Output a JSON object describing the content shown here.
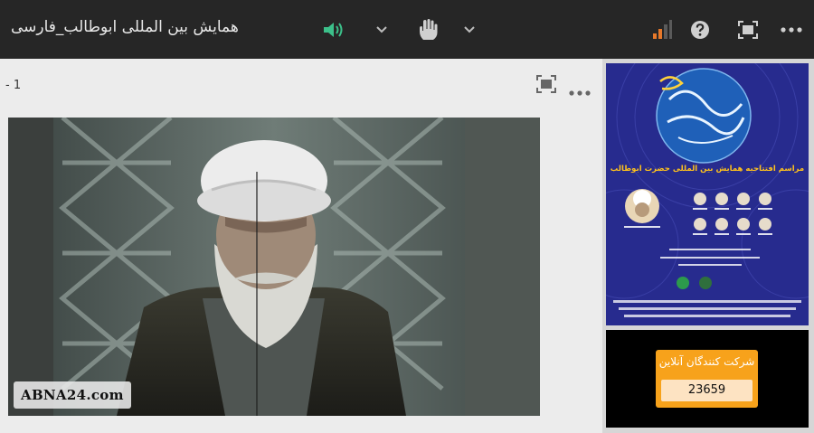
{
  "window": {
    "title": "همایش بین المللی ابوطالب_فارسی"
  },
  "toolbar": {
    "icons": [
      "speaker-icon",
      "chevron-down-icon",
      "raise-hand-icon",
      "chevron-down-icon",
      "signal-bars-icon",
      "help-icon",
      "fullscreen-icon",
      "more-icon"
    ],
    "accent_color": "#3cc08a",
    "signal_color": "#e6782a"
  },
  "main_tile": {
    "label": "- 1",
    "icons": [
      "fullscreen-icon",
      "more-icon"
    ],
    "video": {
      "watermark": "ABNA24.com"
    }
  },
  "poster": {
    "headline": "مراسم افتتاحیه همایش بین المللی حضرت ابوطالب"
  },
  "counter": {
    "label": "شرکت کنندگان آنلاین",
    "value": "23659",
    "box_color": "#f7a21b"
  }
}
